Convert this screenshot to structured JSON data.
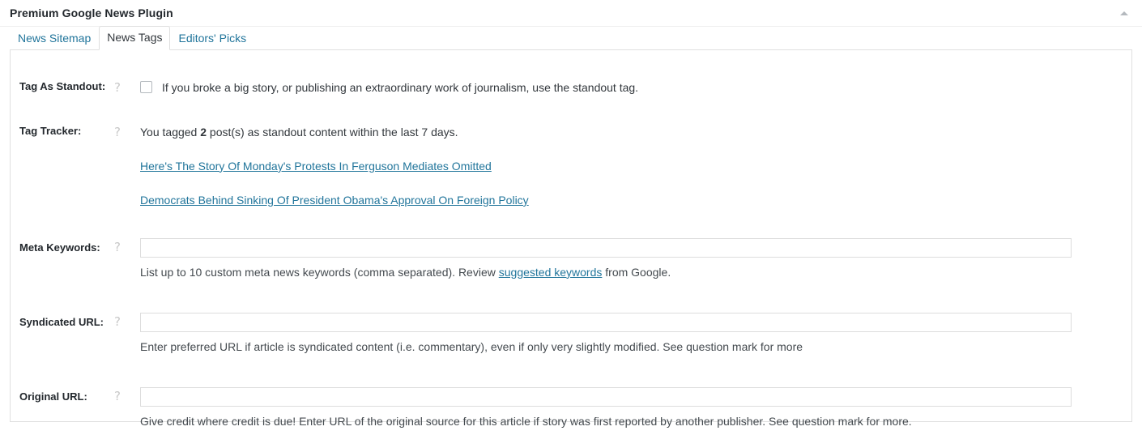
{
  "metabox": {
    "title": "Premium Google News Plugin",
    "toggle_icon": "caret-up-icon",
    "toggle_label": "Toggle panel"
  },
  "tabs": [
    {
      "label": "News Sitemap",
      "active": false,
      "name": "tab-news-sitemap"
    },
    {
      "label": "News Tags",
      "active": true,
      "name": "tab-news-tags"
    },
    {
      "label": "Editors' Picks",
      "active": false,
      "name": "tab-editors-picks"
    }
  ],
  "help_icon_glyph": "?",
  "fields": {
    "standout": {
      "label": "Tag As Standout:",
      "checkbox_checked": false,
      "checkbox_text": "If you broke a big story, or publishing an extraordinary work of journalism, use the standout tag."
    },
    "tracker": {
      "label": "Tag Tracker:",
      "summary_prefix": "You tagged ",
      "count": "2",
      "summary_suffix": " post(s) as standout content within the last 7 days.",
      "links": [
        "Here's The Story Of Monday's Protests In Ferguson Mediates Omitted",
        "Democrats Behind Sinking Of President Obama's Approval On Foreign Policy "
      ]
    },
    "meta_keywords": {
      "label": "Meta Keywords:",
      "value": "",
      "placeholder": "",
      "desc_before": "List up to 10 custom meta news keywords (comma separated). Review ",
      "desc_link": "suggested keywords",
      "desc_after": " from Google."
    },
    "syndicated_url": {
      "label": "Syndicated URL:",
      "value": "",
      "placeholder": "",
      "desc": "Enter preferred URL if article is syndicated content (i.e. commentary), even if only very slightly modified. See question mark for more"
    },
    "original_url": {
      "label": "Original URL:",
      "value": "",
      "placeholder": "",
      "desc": "Give credit where credit is due! Enter URL of the original source for this article if story was first reported by another publisher. See question mark for more."
    }
  },
  "colors": {
    "link": "#21759b",
    "text": "#32373c",
    "label": "#23282d",
    "border": "#dfdfdf",
    "input_border": "#dddddd",
    "help_icon": "#c8c8c8"
  }
}
